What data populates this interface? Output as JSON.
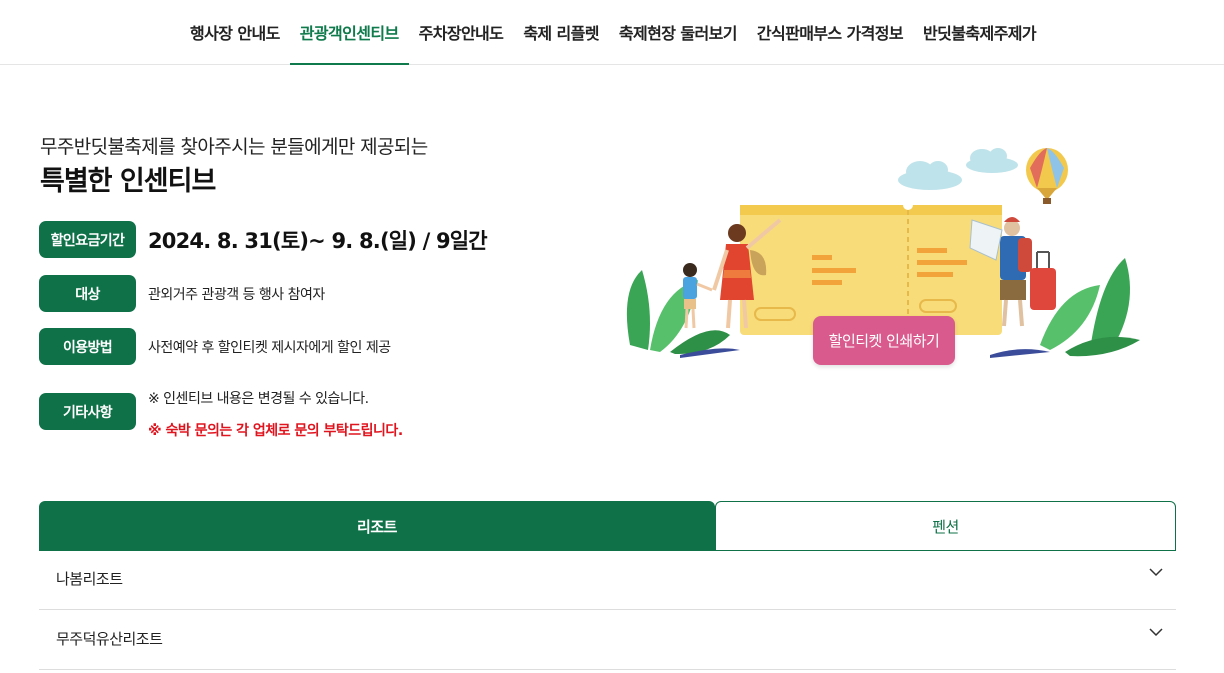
{
  "nav": {
    "items": [
      {
        "label": "행사장 안내도"
      },
      {
        "label": "관광객인센티브",
        "active": true
      },
      {
        "label": "주차장안내도"
      },
      {
        "label": "축제 리플렛"
      },
      {
        "label": "축제현장 둘러보기"
      },
      {
        "label": "간식판매부스 가격정보"
      },
      {
        "label": "반딧불축제주제가"
      }
    ]
  },
  "intro": {
    "subtitle": "무주반딧불축제를 찾아주시는 분들에게만 제공되는",
    "title": "특별한 인센티브"
  },
  "info": {
    "period": {
      "badge": "할인요금기간",
      "text": "2024. 8. 31(토)~ 9. 8.(일) / 9일간"
    },
    "target": {
      "badge": "대상",
      "text": "관외거주 관광객 등 행사 참여자"
    },
    "method": {
      "badge": "이용방법",
      "text": "사전예약 후 할인티켓 제시자에게 할인 제공"
    },
    "etc": {
      "badge": "기타사항",
      "note": "※ 인센티브 내용은 변경될 수 있습니다.",
      "warning": "※ 숙박 문의는 각 업체로 문의 부탁드립니다."
    }
  },
  "illustration": {
    "print_button": "할인티켓 인쇄하기"
  },
  "tabs": [
    {
      "label": "리조트",
      "active": true
    },
    {
      "label": "펜션",
      "active": false
    }
  ],
  "accordion": [
    {
      "label": "나봄리조트"
    },
    {
      "label": "무주덕유산리조트"
    }
  ],
  "colors": {
    "brand_green": "#0f7148",
    "nav_active": "#0f7a4b",
    "print_button": "#d95b8d",
    "warning": "#e0141e"
  }
}
